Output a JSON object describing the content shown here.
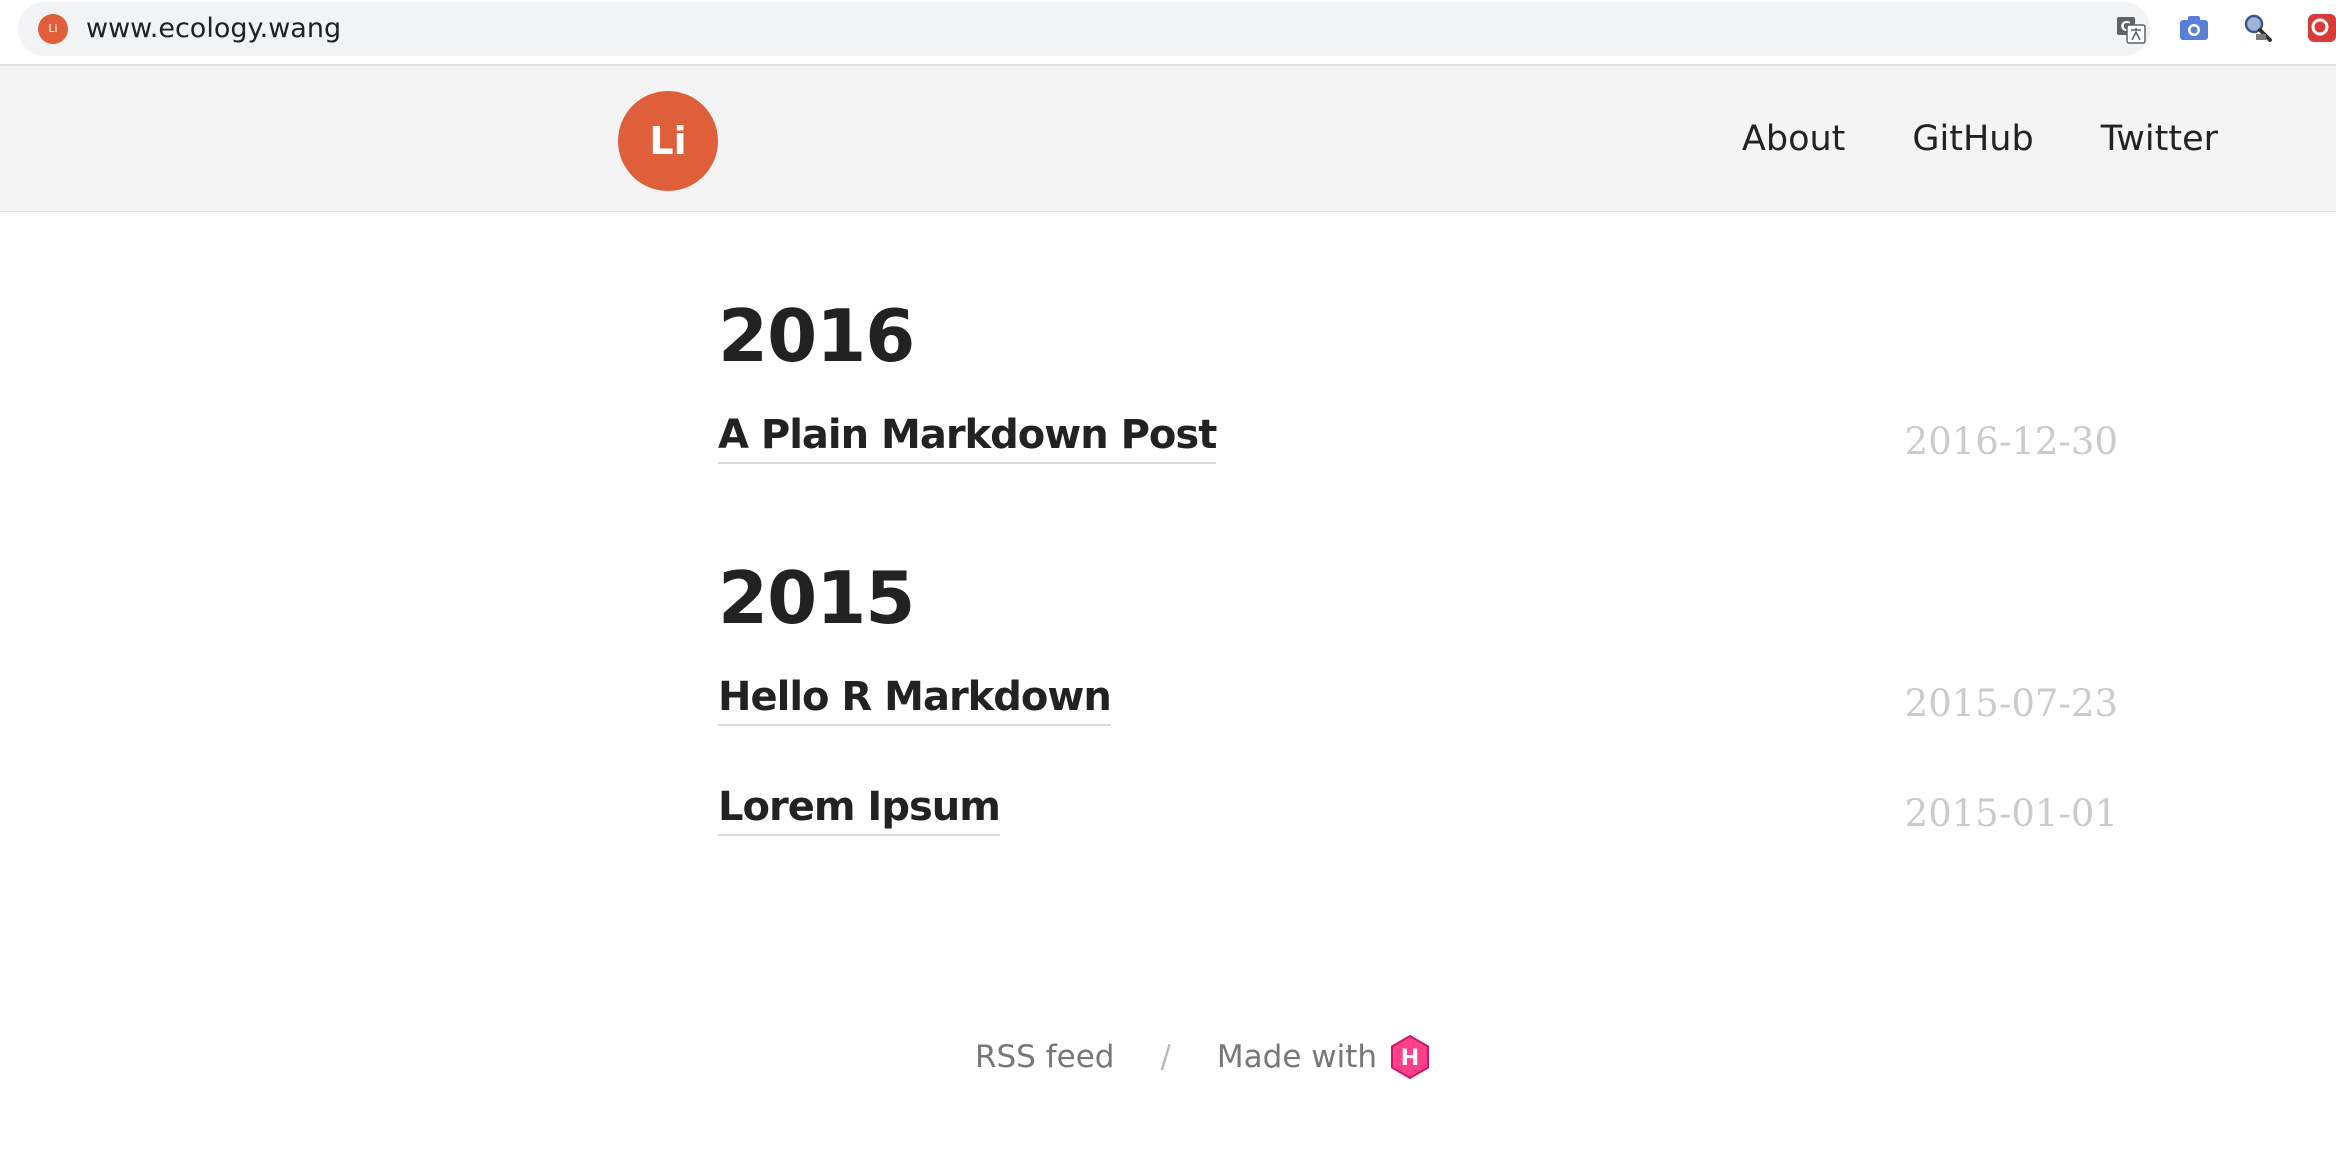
{
  "browser": {
    "url": "www.ecology.wang",
    "favicon_text": "Li",
    "icons": [
      "translate-icon",
      "camera-icon",
      "search-extension-icon",
      "red-extension-icon"
    ]
  },
  "header": {
    "logo_text": "Li",
    "nav": [
      {
        "label": "About"
      },
      {
        "label": "GitHub"
      },
      {
        "label": "Twitter"
      }
    ]
  },
  "archive": [
    {
      "year": "2016",
      "posts": [
        {
          "title": "A Plain Markdown Post",
          "date": "2016-12-30"
        }
      ]
    },
    {
      "year": "2015",
      "posts": [
        {
          "title": "Hello R Markdown",
          "date": "2015-07-23"
        },
        {
          "title": "Lorem Ipsum",
          "date": "2015-01-01"
        }
      ]
    }
  ],
  "footer": {
    "rss_label": "RSS feed",
    "separator": "/",
    "made_with_label": "Made with",
    "hugo_logo_letter": "H"
  },
  "colors": {
    "accent": "#e05f3b",
    "header_bg": "#f4f4f4",
    "date_text": "#cbcbcb",
    "hugo_pink": "#ff4088"
  }
}
